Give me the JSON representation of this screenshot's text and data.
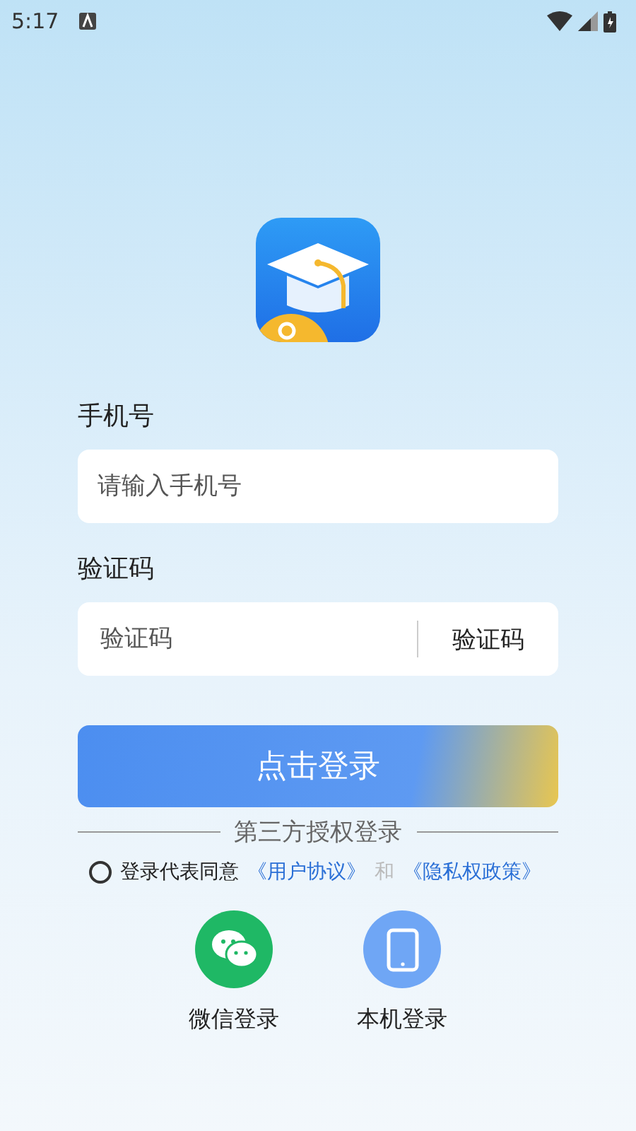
{
  "status_bar": {
    "time": "5:17"
  },
  "phone": {
    "label": "手机号",
    "placeholder": "请输入手机号"
  },
  "code": {
    "label": "验证码",
    "placeholder": "验证码",
    "button": "验证码"
  },
  "login_button": "点击登录",
  "third_party": {
    "title": "第三方授权登录",
    "options": [
      {
        "kind": "wechat",
        "label": "微信登录"
      },
      {
        "kind": "phone",
        "label": "本机登录"
      }
    ]
  },
  "agreement": {
    "agreed": false,
    "prefix": "登录代表同意",
    "link1": "《用户协议》",
    "joiner": "和",
    "link2": "《隐私权政策》"
  }
}
